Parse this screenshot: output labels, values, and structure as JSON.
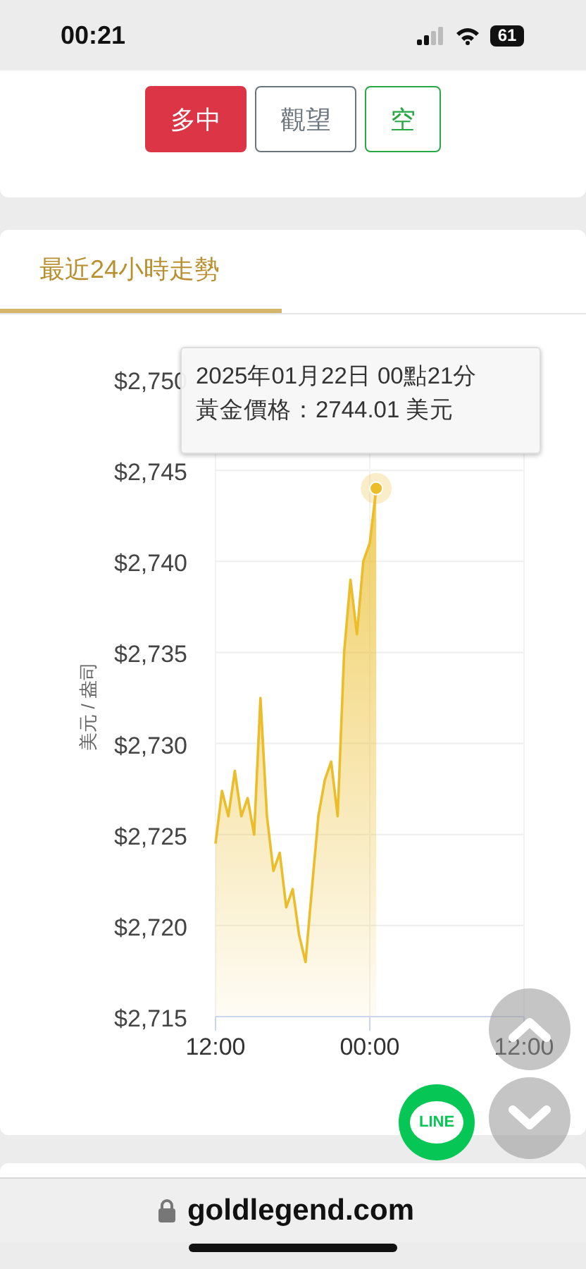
{
  "status_bar": {
    "time": "00:21",
    "battery": "61"
  },
  "signal_buttons": [
    {
      "label": "多中",
      "selected": true,
      "color": "#dc3545"
    },
    {
      "label": "觀望",
      "selected": false,
      "color": "#6c757d"
    },
    {
      "label": "空",
      "selected": false,
      "color": "#28a745"
    }
  ],
  "trend_card": {
    "tabs": [
      {
        "label": "最近24小時走勢",
        "selected": true
      }
    ],
    "chart_data": {
      "type": "area",
      "ylabel": "美元 / 盎司",
      "categories": [
        "12:00",
        null,
        null,
        null,
        null,
        null,
        null,
        null,
        null,
        null,
        null,
        null,
        null,
        null,
        null,
        null,
        null,
        null,
        null,
        null,
        null,
        null,
        null,
        null,
        "00:00",
        null,
        null,
        null,
        null,
        null,
        null,
        null,
        null,
        null,
        null,
        null,
        null,
        null,
        null,
        null,
        null,
        null,
        null,
        null,
        null,
        null,
        null,
        null,
        "12:00"
      ],
      "series": [
        {
          "color": "#ebbd2b",
          "values": [
            2724.5,
            2727.4,
            2726,
            2728.5,
            2726,
            2727,
            2725,
            2732.5,
            2726,
            2723,
            2724,
            2721,
            2722,
            2719.5,
            2718,
            2722,
            2726,
            2728,
            2729,
            2726,
            2735,
            2739,
            2736,
            2740,
            2741,
            2744.01,
            null,
            null,
            null,
            null,
            null,
            null,
            null,
            null,
            null,
            null,
            null,
            null,
            null,
            null,
            null,
            null,
            null,
            null,
            null,
            null,
            null,
            null,
            null
          ]
        }
      ],
      "ylim": [
        2715,
        2750
      ],
      "grid": true,
      "yticks": [
        {
          "value": 2715,
          "label": "$2,715"
        },
        {
          "value": 2720,
          "label": "$2,720"
        },
        {
          "value": 2725,
          "label": "$2,725"
        },
        {
          "value": 2730,
          "label": "$2,730"
        },
        {
          "value": 2735,
          "label": "$2,735"
        },
        {
          "value": 2740,
          "label": "$2,740"
        },
        {
          "value": 2745,
          "label": "$2,745"
        },
        {
          "value": 2750,
          "label": "$2,750"
        }
      ]
    },
    "tooltip": {
      "lines": [
        "2025年01月22日 00點21分",
        "黃金價格：2744.01 美元"
      ]
    }
  },
  "line_button": {
    "label": "LINE"
  },
  "browser": {
    "url": "goldlegend.com"
  }
}
